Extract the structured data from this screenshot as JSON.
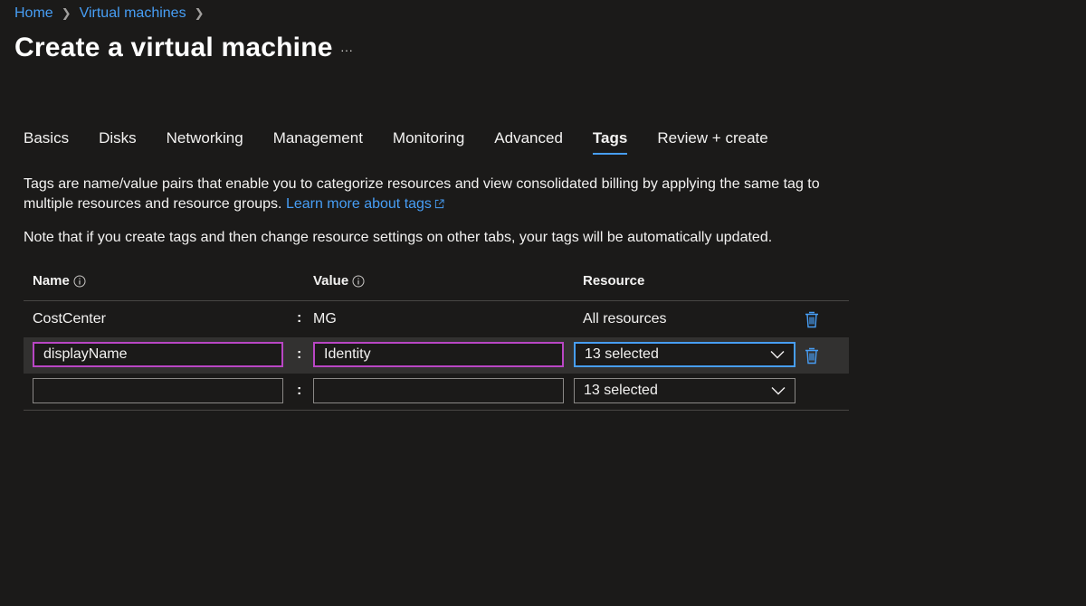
{
  "breadcrumb": {
    "items": [
      "Home",
      "Virtual machines"
    ]
  },
  "page": {
    "title": "Create a virtual machine",
    "more_label": "···"
  },
  "tabs": [
    {
      "label": "Basics",
      "active": false
    },
    {
      "label": "Disks",
      "active": false
    },
    {
      "label": "Networking",
      "active": false
    },
    {
      "label": "Management",
      "active": false
    },
    {
      "label": "Monitoring",
      "active": false
    },
    {
      "label": "Advanced",
      "active": false
    },
    {
      "label": "Tags",
      "active": true
    },
    {
      "label": "Review + create",
      "active": false
    }
  ],
  "description": {
    "text": "Tags are name/value pairs that enable you to categorize resources and view consolidated billing by applying the same tag to multiple resources and resource groups.",
    "link_label": "Learn more about tags",
    "note": "Note that if you create tags and then change resource settings on other tabs, your tags will be automatically updated."
  },
  "table": {
    "headers": {
      "name": "Name",
      "value": "Value",
      "resource": "Resource"
    },
    "separator": ":",
    "rows": [
      {
        "name": "CostCenter",
        "value": "MG",
        "resource": "All resources"
      },
      {
        "name": "displayName",
        "value": "Identity",
        "resource": "13 selected"
      },
      {
        "name": "",
        "value": "",
        "resource": "13 selected"
      }
    ]
  },
  "colors": {
    "background": "#1b1a19",
    "link": "#479ef5",
    "focus_input_border": "#b946c4",
    "focus_dropdown_border": "#479ef5",
    "trash_icon": "#479ef5"
  },
  "icons": [
    "chevron-right-icon",
    "more-icon",
    "external-link-icon",
    "info-icon",
    "chevron-down-icon",
    "trash-icon"
  ]
}
